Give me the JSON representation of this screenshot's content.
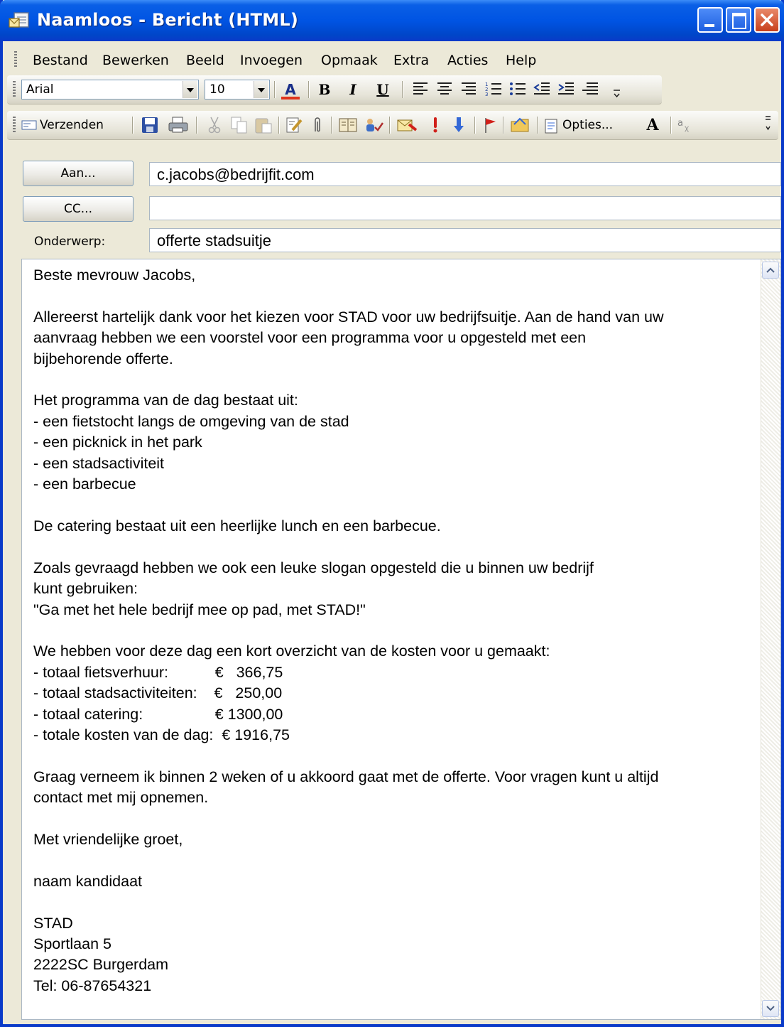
{
  "window": {
    "title": "Naamloos - Bericht (HTML)"
  },
  "menu": [
    "Bestand",
    "Bewerken",
    "Beeld",
    "Invoegen",
    "Opmaak",
    "Extra",
    "Acties",
    "Help"
  ],
  "format_toolbar": {
    "font": "Arial",
    "size": "10",
    "bold": "B",
    "italic": "I",
    "underline": "U",
    "font_color_glyph": "A"
  },
  "standard_toolbar": {
    "send_label": "Verzenden",
    "options_label": "Opties...",
    "font_size_glyph": "A"
  },
  "address": {
    "to_button": "Aan...",
    "to_value": "c.jacobs@bedrijfit.com",
    "cc_button": "CC...",
    "cc_value": "",
    "subject_label": "Onderwerp:",
    "subject_value": "offerte stadsuitje"
  },
  "message": {
    "body": "Beste mevrouw Jacobs,\n\nAllereerst hartelijk dank voor het kiezen voor STAD voor uw bedrijfsuitje. Aan de hand van uw\naanvraag hebben we een voorstel voor een programma voor u opgesteld met een\nbijbehorende offerte.\n\nHet programma van de dag bestaat uit:\n- een fietstocht langs de omgeving van de stad\n- een picknick in het park\n- een stadsactiviteit\n- een barbecue\n\nDe catering bestaat uit een heerlijke lunch en een barbecue.\n\nZoals gevraagd hebben we ook een leuke slogan opgesteld die u binnen uw bedrijf\nkunt gebruiken:\n\"Ga met het hele bedrijf mee op pad, met STAD!\"\n\nWe hebben voor deze dag een kort overzicht van de kosten voor u gemaakt:\n- totaal fietsverhuur:           €   366,75\n- totaal stadsactiviteiten:    €   250,00\n- totaal catering:                 € 1300,00\n- totale kosten van de dag:  € 1916,75\n\nGraag verneem ik binnen 2 weken of u akkoord gaat met de offerte. Voor vragen kunt u altijd\ncontact met mij opnemen.\n\nMet vriendelijke groet,\n\nnaam kandidaat\n\nSTAD\nSportlaan 5\n2222SC Burgerdam\nTel: 06-87654321"
  },
  "colors": {
    "titlebar": "#0054e3",
    "chrome": "#ece9d8",
    "font_color_bar": "#e0341c"
  }
}
